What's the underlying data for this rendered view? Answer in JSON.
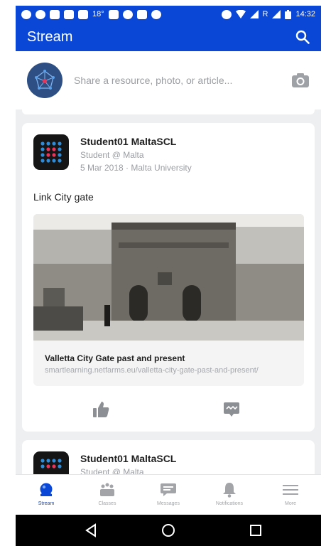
{
  "status_bar": {
    "temp": "18°",
    "network": "R",
    "time": "14:32"
  },
  "app_bar": {
    "title": "Stream"
  },
  "composer": {
    "placeholder": "Share a resource, photo, or article..."
  },
  "posts": [
    {
      "author": "Student01 MaltaSCL",
      "role": "Student @ Malta",
      "date_place": "5 Mar 2018 · Malta University",
      "text": "Link City gate",
      "link": {
        "title": "Valletta City Gate past and present",
        "url": "smartlearning.netfarms.eu/valletta-city-gate-past-and-present/"
      }
    },
    {
      "author": "Student01 MaltaSCL",
      "role": "Student @ Malta"
    }
  ],
  "bottom_nav": [
    {
      "label": "Stream",
      "icon": "stream-icon",
      "active": true
    },
    {
      "label": "Classes",
      "icon": "classes-icon",
      "active": false
    },
    {
      "label": "Messages",
      "icon": "messages-icon",
      "active": false
    },
    {
      "label": "Notifications",
      "icon": "bell-icon",
      "active": false
    },
    {
      "label": "More",
      "icon": "menu-icon",
      "active": false
    }
  ],
  "colors": {
    "primary": "#0a47d6",
    "background": "#eeeff1",
    "muted": "#9a9da2"
  }
}
